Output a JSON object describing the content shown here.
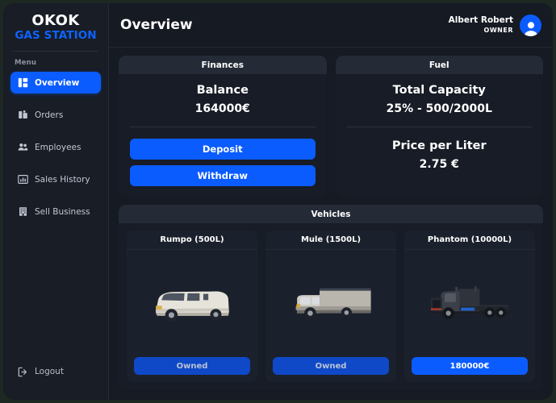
{
  "brand": {
    "line1": "OKOK",
    "line2": "GAS STATION"
  },
  "sidebar": {
    "menu_label": "Menu",
    "items": [
      {
        "label": "Overview",
        "icon": "dashboard-grid-icon",
        "active": true
      },
      {
        "label": "Orders",
        "icon": "orders-clipboard-icon",
        "active": false
      },
      {
        "label": "Employees",
        "icon": "people-icon",
        "active": false
      },
      {
        "label": "Sales History",
        "icon": "bar-chart-icon",
        "active": false
      },
      {
        "label": "Sell Business",
        "icon": "building-icon",
        "active": false
      }
    ],
    "logout": {
      "label": "Logout",
      "icon": "logout-icon"
    }
  },
  "header": {
    "title": "Overview",
    "user_name": "Albert Robert",
    "user_role": "OWNER",
    "avatar_icon": "user-avatar-icon"
  },
  "finances": {
    "panel_title": "Finances",
    "balance_label": "Balance",
    "balance_value": "164000€",
    "deposit_label": "Deposit",
    "withdraw_label": "Withdraw"
  },
  "fuel": {
    "panel_title": "Fuel",
    "capacity_label": "Total Capacity",
    "capacity_value": "25% - 500/2000L",
    "price_label": "Price per Liter",
    "price_value": "2.75  €"
  },
  "vehicles": {
    "panel_title": "Vehicles",
    "items": [
      {
        "name": "Rumpo (500L)",
        "image": "white-van-image",
        "action": "Owned",
        "state": "owned"
      },
      {
        "name": "Mule (1500L)",
        "image": "box-truck-image",
        "action": "Owned",
        "state": "owned"
      },
      {
        "name": "Phantom (10000L)",
        "image": "semi-truck-image",
        "action": "180000€",
        "state": "buy"
      }
    ]
  },
  "colors": {
    "accent": "#0b5cff",
    "brand_blue": "#0e63ff",
    "window_bg": "#151a23",
    "sidebar_bg": "#181d26",
    "panel_bg": "#171c26",
    "panel_head_bg": "#242a36",
    "card_bg": "#1b212c",
    "owned_btn": "#0f49c8",
    "desktop_bg": "#1e2822"
  }
}
